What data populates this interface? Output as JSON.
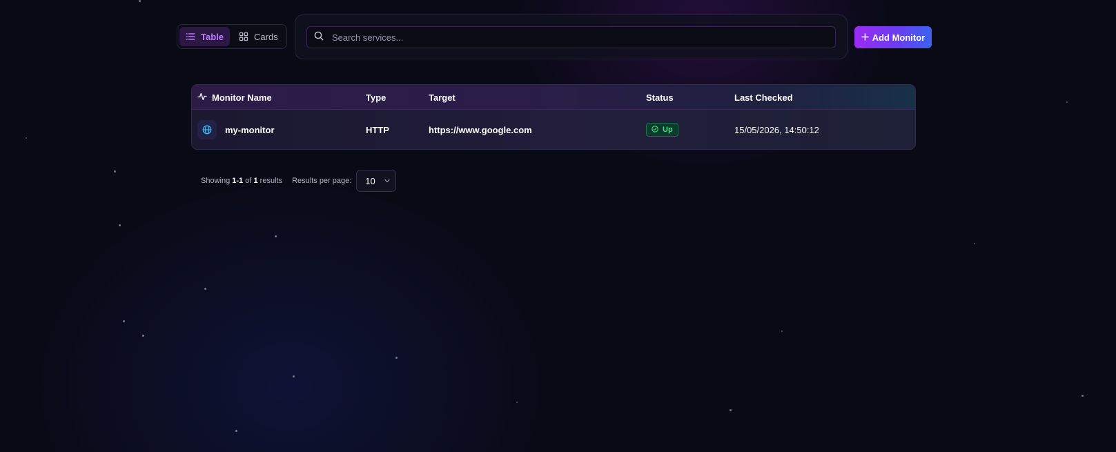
{
  "view_toggle": {
    "table_label": "Table",
    "cards_label": "Cards",
    "active": "Table"
  },
  "search": {
    "placeholder": "Search services...",
    "value": ""
  },
  "toolbar": {
    "add_monitor_label": "Add Monitor"
  },
  "table": {
    "columns": [
      "Monitor Name",
      "Type",
      "Target",
      "Status",
      "Last Checked"
    ],
    "rows": [
      {
        "name": "my-monitor",
        "type": "HTTP",
        "target": "https://www.google.com",
        "status": "Up",
        "last_checked": "15/05/2026, 14:50:12"
      }
    ]
  },
  "pagination": {
    "showing_prefix": "Showing",
    "range": "1-1",
    "of_word": "of",
    "total": "1",
    "results_word": "results",
    "per_page_label": "Results per page:",
    "per_page_value": "10"
  },
  "colors": {
    "background": "#0a0a17",
    "accent_purple": "#c07bff",
    "status_up": "#3ee08a",
    "button_gradient_start": "#9b2cf5",
    "button_gradient_end": "#3b62f0"
  },
  "icons": {
    "table_view": "list-icon",
    "cards_view": "grid-icon",
    "search": "search-icon",
    "add": "plus-icon",
    "monitor_header": "activity-icon",
    "row_type": "globe-icon",
    "status": "check-circle-icon",
    "dropdown": "chevron-down-icon"
  }
}
